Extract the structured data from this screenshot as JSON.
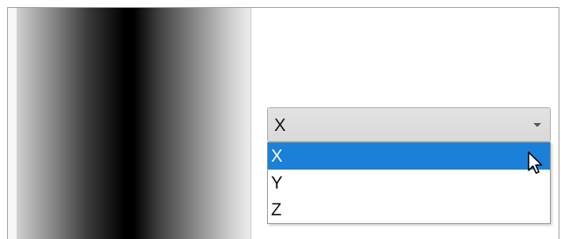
{
  "preview": {
    "description_icon": "gradient-preview"
  },
  "combo": {
    "selected_value": "X",
    "arrow_icon": "chevron-down-icon"
  },
  "dropdown": {
    "options": [
      {
        "label": "X",
        "selected": true
      },
      {
        "label": "Y",
        "selected": false
      },
      {
        "label": "Z",
        "selected": false
      }
    ]
  },
  "colors": {
    "selection_highlight": "#1a80d8",
    "combo_background": "#d9d9d9"
  },
  "cursor": {
    "icon": "mouse-pointer-icon"
  }
}
